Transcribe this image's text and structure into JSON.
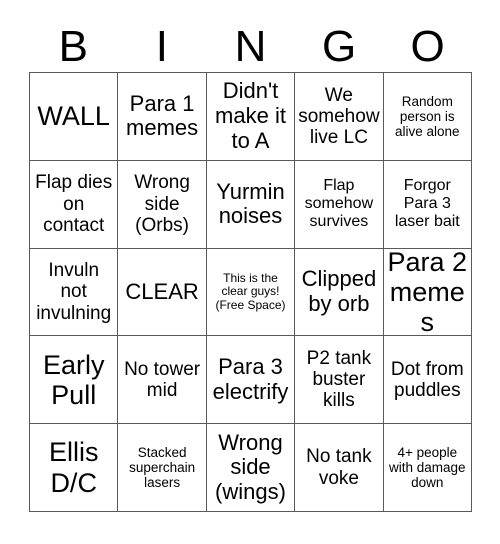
{
  "card": {
    "headers": [
      "B",
      "I",
      "N",
      "G",
      "O"
    ],
    "rows": [
      [
        {
          "text": "WALL",
          "size": "xl"
        },
        {
          "text": "Para 1 memes",
          "size": "lg"
        },
        {
          "text": "Didn't make it to A",
          "size": "lg"
        },
        {
          "text": "We somehow live LC",
          "size": "md"
        },
        {
          "text": "Random person is alive alone",
          "size": "xs"
        }
      ],
      [
        {
          "text": "Flap dies on contact",
          "size": "md"
        },
        {
          "text": "Wrong side (Orbs)",
          "size": "md"
        },
        {
          "text": "Yurmin noises",
          "size": "lg"
        },
        {
          "text": "Flap somehow survives",
          "size": "sm"
        },
        {
          "text": "Forgor Para 3 laser bait",
          "size": "sm"
        }
      ],
      [
        {
          "text": "Invuln not invulning",
          "size": "md"
        },
        {
          "text": "CLEAR",
          "size": "lg"
        },
        {
          "text": "This is the clear guys! (Free Space)",
          "size": "xxs"
        },
        {
          "text": "Clipped by orb",
          "size": "lg"
        },
        {
          "text": "Para 2 memes",
          "size": "xl"
        }
      ],
      [
        {
          "text": "Early Pull",
          "size": "xl"
        },
        {
          "text": "No tower mid",
          "size": "md"
        },
        {
          "text": "Para 3 electrify",
          "size": "lg"
        },
        {
          "text": "P2 tank buster kills",
          "size": "md"
        },
        {
          "text": "Dot from puddles",
          "size": "md"
        }
      ],
      [
        {
          "text": "Ellis D/C",
          "size": "xl"
        },
        {
          "text": "Stacked superchain lasers",
          "size": "xs"
        },
        {
          "text": "Wrong side (wings)",
          "size": "lg"
        },
        {
          "text": "No tank voke",
          "size": "md"
        },
        {
          "text": "4+ people with damage down",
          "size": "xs"
        }
      ]
    ]
  },
  "colors": {
    "background": "#ffffff",
    "text": "#000000",
    "grid_line": "#5a5a5a"
  }
}
